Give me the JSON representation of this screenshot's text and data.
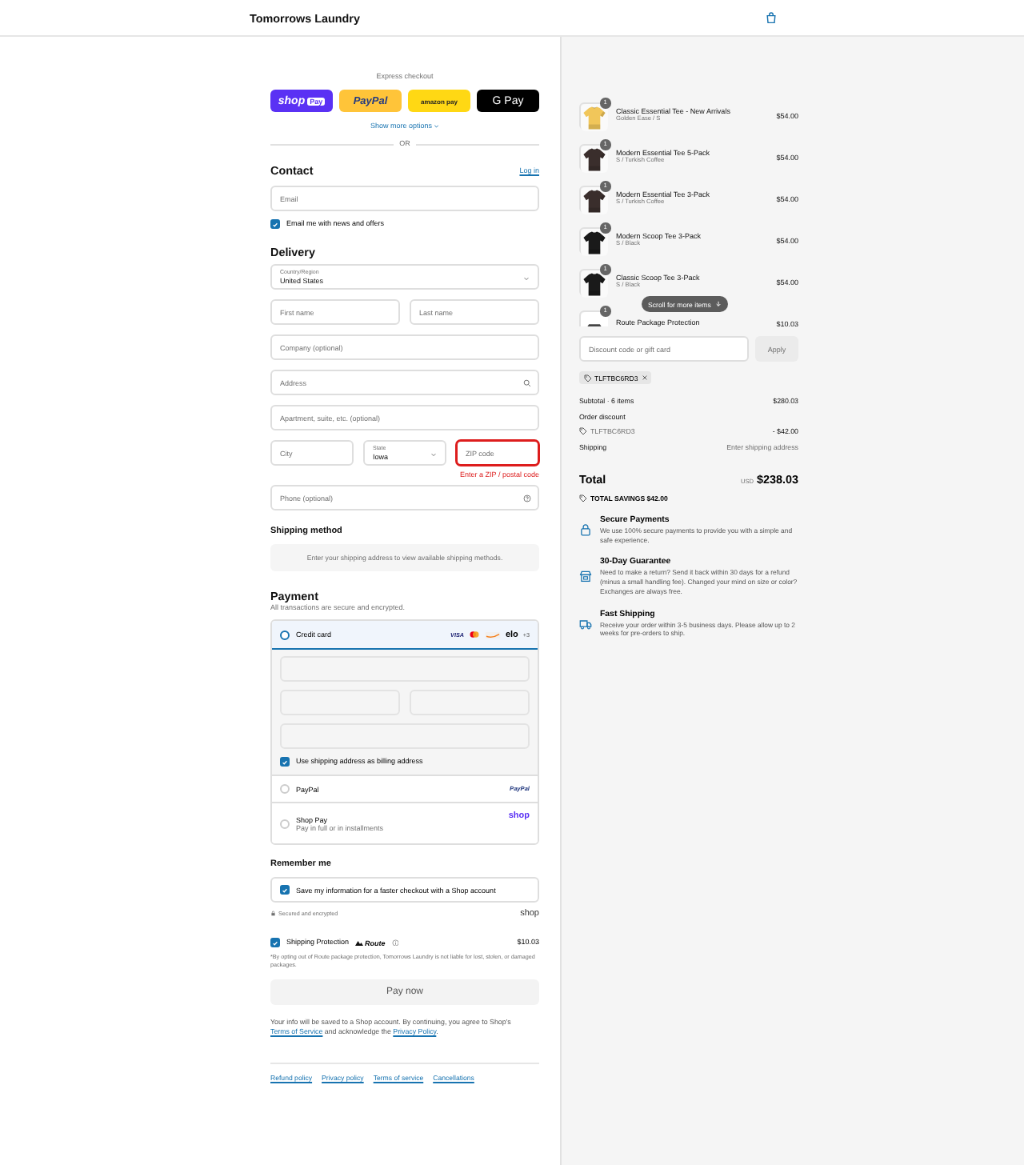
{
  "header": {
    "store_name": "Tomorrows Laundry"
  },
  "express_checkout": {
    "label": "Express checkout",
    "buttons": [
      {
        "kind": "shop",
        "label": "shop",
        "badge": "Pay"
      },
      {
        "kind": "paypal",
        "label": "PayPal"
      },
      {
        "kind": "amazon",
        "label": "amazon pay"
      },
      {
        "kind": "gpay",
        "label": "G Pay"
      }
    ],
    "more_options": "Show more options",
    "divider": "OR"
  },
  "contact": {
    "title": "Contact",
    "login": "Log in",
    "email": {
      "placeholder": "Email"
    },
    "news": {
      "label": "Email me with news and offers",
      "checked": true
    }
  },
  "delivery": {
    "title": "Delivery",
    "country": {
      "label": "Country/Region",
      "value": "United States"
    },
    "first_name": {
      "placeholder": "First name"
    },
    "last_name": {
      "placeholder": "Last name"
    },
    "company": {
      "placeholder": "Company (optional)"
    },
    "address": {
      "placeholder": "Address"
    },
    "apartment": {
      "placeholder": "Apartment, suite, etc. (optional)"
    },
    "city": {
      "placeholder": "City"
    },
    "state": {
      "label": "State",
      "value": "Iowa"
    },
    "zip": {
      "placeholder": "ZIP code",
      "invalid": true,
      "error": "Enter a ZIP / postal code"
    },
    "phone": {
      "placeholder": "Phone (optional)"
    }
  },
  "shipping_method": {
    "title": "Shipping method",
    "message": "Enter your shipping address to view available shipping methods."
  },
  "payment": {
    "title": "Payment",
    "subtitle": "All transactions are secure and encrypted.",
    "methods": [
      {
        "kind": "card",
        "label": "Credit card",
        "selected": true,
        "brands": [
          "VISA",
          "elo",
          "+3"
        ]
      },
      {
        "kind": "paypal",
        "label": "PayPal",
        "logo": "PayPal",
        "selected": false
      },
      {
        "kind": "shop",
        "label": "Shop Pay",
        "sublabel": "Pay in full or in installments",
        "logo": "shop",
        "selected": false
      }
    ],
    "billing_same": {
      "label": "Use shipping address as billing address",
      "checked": true
    }
  },
  "remember": {
    "title": "Remember me",
    "save": {
      "label": "Save my information for a faster checkout with a Shop account",
      "checked": true
    },
    "secure": "Secured and encrypted",
    "logo": "shop"
  },
  "protection": {
    "label": "Shipping Protection",
    "brand": "Route",
    "checked": true,
    "price": "$10.03",
    "note": "*By opting out of Route package protection, Tomorrows Laundry is not liable for lost, stolen, or damaged packages."
  },
  "pay_button": "Pay now",
  "notice": {
    "before": "Your info will be saved to a Shop account. By continuing, you agree to Shop's",
    "link1": "Terms of Service",
    "middle": "and acknowledge the",
    "link2": "Privacy Policy",
    "after": "."
  },
  "footer_links": [
    "Refund policy",
    "Privacy policy",
    "Terms of service",
    "Cancellations"
  ],
  "cart": {
    "items": [
      {
        "kind": "product",
        "name": "Classic Essential Tee - New Arrivals",
        "variant": "Golden Ease / S",
        "price": "$54.00",
        "quantity": "1"
      },
      {
        "kind": "product",
        "name": "Modern Essential Tee 5-Pack",
        "variant": "S / Turkish Coffee",
        "price": "$54.00",
        "quantity": "1"
      },
      {
        "kind": "product",
        "name": "Modern Essential Tee 3-Pack",
        "variant": "S / Turkish Coffee",
        "price": "$54.00",
        "quantity": "1"
      },
      {
        "kind": "product",
        "name": "Modern Scoop Tee 3-Pack",
        "variant": "S / Black",
        "price": "$54.00",
        "quantity": "1"
      },
      {
        "kind": "product",
        "name": "Classic Scoop Tee 3-Pack",
        "variant": "S / Black",
        "price": "$54.00",
        "quantity": "1"
      },
      {
        "kind": "protection",
        "name": "Route Package Protection",
        "price": "$10.03",
        "quantity": "1"
      }
    ],
    "scroll_hint": "Scroll for more items"
  },
  "discount": {
    "placeholder": "Discount code or gift card",
    "apply": "Apply",
    "codes": [
      "TLFTBC6RD3"
    ]
  },
  "summary": {
    "subtotal_label": "Subtotal · 6 items",
    "subtotal": "$280.03",
    "discount_label": "Order discount",
    "discount_code": "TLFTBC6RD3",
    "discount_amount": "- $42.00",
    "shipping_label": "Shipping",
    "shipping_value": "Enter shipping address",
    "total_label": "Total",
    "currency": "USD",
    "total": "$238.03",
    "savings": "TOTAL SAVINGS $42.00"
  },
  "benefits": [
    {
      "kind": "lock",
      "title": "Secure Payments",
      "text": "We use 100% secure payments to provide you with a simple and safe experience."
    },
    {
      "kind": "store",
      "title": "30-Day Guarantee",
      "text": "Need to make a return? Send it back within 30 days for a refund (minus a small handling fee). Changed your mind on size or color? Exchanges are always free."
    },
    {
      "kind": "truck",
      "title": "Fast Shipping",
      "text": "Receive your order within 3-5 business days. Please allow up to 2 weeks for pre-orders to ship."
    }
  ]
}
